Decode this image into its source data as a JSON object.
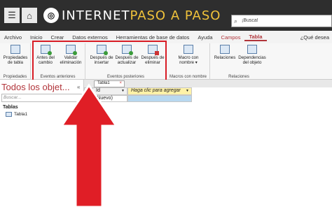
{
  "header": {
    "logo_text_white": "INTERNET",
    "logo_text_accent": "PASO A PASO",
    "search_placeholder": "¡Busca!"
  },
  "menu": {
    "items": [
      "Archivo",
      "Inicio",
      "Crear",
      "Datos externos",
      "Herramientas de base de datos",
      "Ayuda"
    ],
    "context_tab": "Campos",
    "active_tab": "Tabla",
    "help_search": "¿Qué desea"
  },
  "ribbon": {
    "groups": [
      {
        "label": "Propiedades",
        "buttons": [
          "Propiedades de tabla"
        ]
      },
      {
        "label": "Eventos anteriores",
        "buttons": [
          "Antes del cambio",
          "Validar eliminación"
        ]
      },
      {
        "label": "Eventos posteriores",
        "buttons": [
          "Después de insertar",
          "Después de actualizar",
          "Después de eliminar"
        ]
      },
      {
        "label": "Macros con nombre",
        "buttons": [
          "Macro con nombre ▾"
        ]
      },
      {
        "label": "Relaciones",
        "buttons": [
          "Relaciones",
          "Dependencias del objeto"
        ]
      }
    ]
  },
  "nav": {
    "title": "Todos los objet...",
    "search_placeholder": "Buscar...",
    "section": "Tablas",
    "items": [
      "Tabla1"
    ]
  },
  "document": {
    "tab": "Tabla1"
  },
  "grid": {
    "columns": [
      "Id",
      "Haga clic para agregar"
    ],
    "rows": [
      [
        "(Nuevo)",
        ""
      ]
    ]
  },
  "colors": {
    "accent": "#b1343a",
    "highlight": "#d81c25",
    "header_bg": "#2e2e2e"
  }
}
